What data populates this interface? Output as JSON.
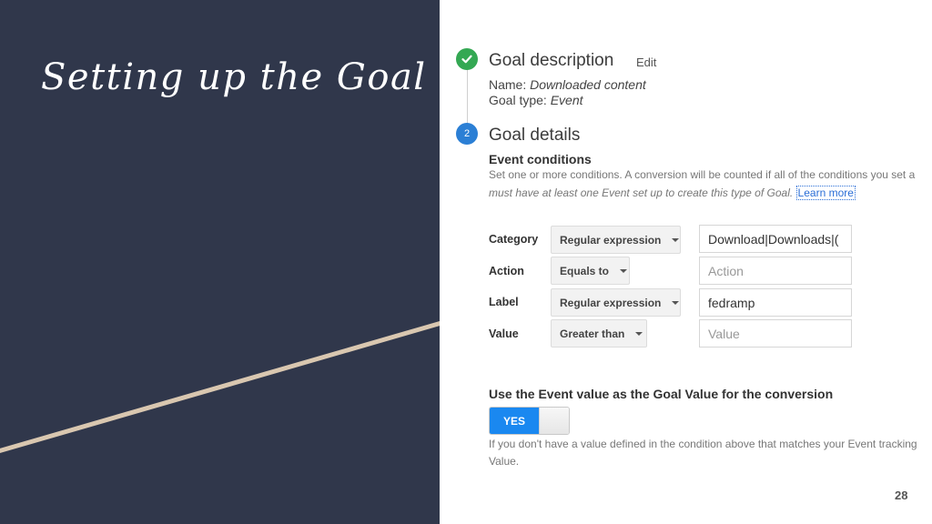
{
  "slide": {
    "title": "Setting up the Goal",
    "page_number": "28",
    "colors": {
      "left_panel_bg": "#30374b",
      "accent_line": "#d9c7b0"
    }
  },
  "steps": [
    {
      "badge_icon": "checkmark-icon",
      "badge_text": "✓",
      "title": "Goal description",
      "edit_label": "Edit",
      "name_label": "Name:",
      "name_value": "Downloaded content",
      "type_label": "Goal type:",
      "type_value": "Event",
      "status_color": "#34a853"
    },
    {
      "badge_text": "2",
      "title": "Goal details",
      "status_color": "#2b7fd5"
    }
  ],
  "event_conditions": {
    "heading": "Event conditions",
    "helper_line1": "Set one or more conditions. A conversion will be counted if all of the conditions you set a",
    "helper_line2": "must have at least one Event set up to create this type of Goal.",
    "learn_more": "Learn more",
    "rows": [
      {
        "label": "Category",
        "operator": "Regular expression",
        "value": "Download|Downloads|(",
        "placeholder": ""
      },
      {
        "label": "Action",
        "operator": "Equals to",
        "value": "",
        "placeholder": "Action"
      },
      {
        "label": "Label",
        "operator": "Regular expression",
        "value": "fedramp",
        "placeholder": ""
      },
      {
        "label": "Value",
        "operator": "Greater than",
        "value": "",
        "placeholder": "Value"
      }
    ]
  },
  "goal_value": {
    "heading": "Use the Event value as the Goal Value for the conversion",
    "toggle_label": "YES",
    "toggle_on": true,
    "helper_line1": "If you don't have a value defined in the condition above that matches your Event tracking",
    "helper_line2": "Value."
  }
}
